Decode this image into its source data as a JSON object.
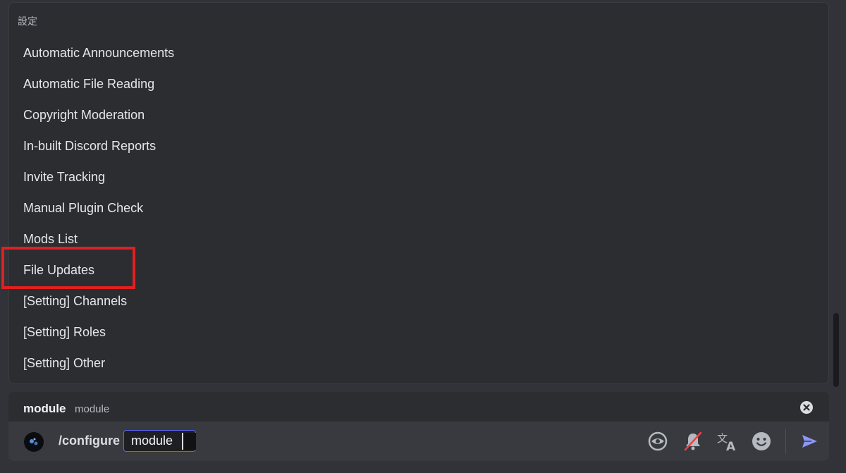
{
  "popup": {
    "section_title": "設定",
    "options": [
      "Automatic Announcements",
      "Automatic File Reading",
      "Copyright Moderation",
      "In-built Discord Reports",
      "Invite Tracking",
      "Manual Plugin Check",
      "Mods List",
      "File Updates",
      "[Setting] Channels",
      "[Setting] Roles",
      "[Setting] Other"
    ],
    "highlighted_option": "File Updates"
  },
  "param": {
    "name": "module",
    "description": "module"
  },
  "composer": {
    "command": "/configure",
    "option_label": "module"
  },
  "icons": {
    "clear": "close-circle-icon",
    "eye": "eye-icon",
    "silent": "bell-slash-icon",
    "translate": "translate-icon",
    "emoji": "emoji-icon",
    "send": "send-icon"
  },
  "colors": {
    "accent": "#5865f2",
    "highlight_box": "#e02020",
    "mute_slash": "#ed4245"
  }
}
